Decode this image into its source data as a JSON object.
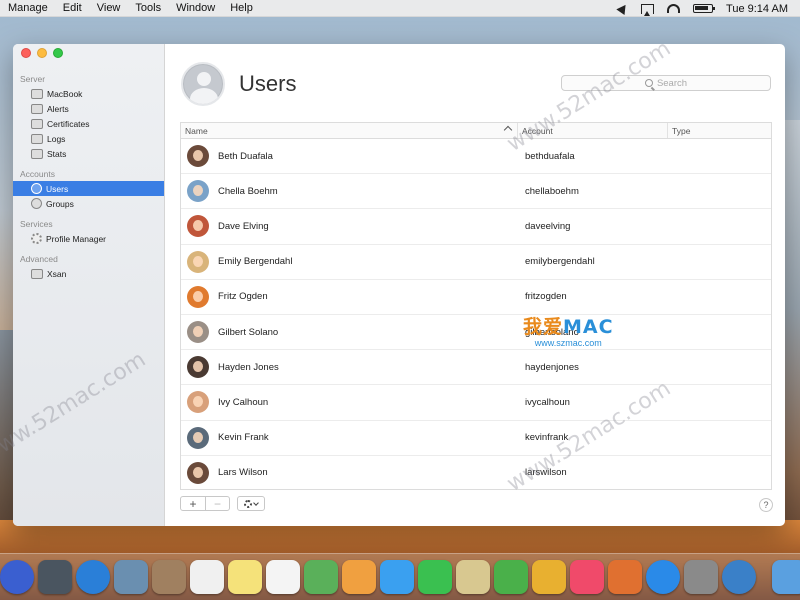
{
  "menubar": {
    "items": [
      "Manage",
      "Edit",
      "View",
      "Tools",
      "Window",
      "Help"
    ],
    "clock": "Tue 9:14 AM"
  },
  "sidebar": {
    "sections": [
      {
        "title": "Server",
        "items": [
          {
            "label": "MacBook",
            "icon": "laptop-icon"
          },
          {
            "label": "Alerts",
            "icon": "alert-icon"
          },
          {
            "label": "Certificates",
            "icon": "certificate-icon"
          },
          {
            "label": "Logs",
            "icon": "logs-icon"
          },
          {
            "label": "Stats",
            "icon": "stats-icon"
          }
        ]
      },
      {
        "title": "Accounts",
        "items": [
          {
            "label": "Users",
            "icon": "user-icon",
            "selected": true
          },
          {
            "label": "Groups",
            "icon": "groups-icon"
          }
        ]
      },
      {
        "title": "Services",
        "items": [
          {
            "label": "Profile Manager",
            "icon": "profile-manager-icon"
          }
        ]
      },
      {
        "title": "Advanced",
        "items": [
          {
            "label": "Xsan",
            "icon": "xsan-icon"
          }
        ]
      }
    ]
  },
  "main": {
    "title": "Users",
    "search_placeholder": "Search",
    "columns": {
      "name": "Name",
      "account": "Account",
      "type": "Type"
    },
    "users": [
      {
        "name": "Beth Duafala",
        "account": "bethduafala",
        "color": "#6b4a3a"
      },
      {
        "name": "Chella Boehm",
        "account": "chellaboehm",
        "color": "#7aa2c8"
      },
      {
        "name": "Dave Elving",
        "account": "daveelving",
        "color": "#c0563a"
      },
      {
        "name": "Emily Bergendahl",
        "account": "emilybergendahl",
        "color": "#d9b47a"
      },
      {
        "name": "Fritz Ogden",
        "account": "fritzogden",
        "color": "#e07a2e"
      },
      {
        "name": "Gilbert Solano",
        "account": "gilbertsolano",
        "color": "#9a8f86"
      },
      {
        "name": "Hayden Jones",
        "account": "haydenjones",
        "color": "#4a3a32"
      },
      {
        "name": "Ivy Calhoun",
        "account": "ivycalhoun",
        "color": "#d8a07a"
      },
      {
        "name": "Kevin Frank",
        "account": "kevinfrank",
        "color": "#5a6a7a"
      },
      {
        "name": "Lars Wilson",
        "account": "larswilson",
        "color": "#6a4a3a"
      }
    ],
    "add_label": "+",
    "remove_label": "−",
    "help_label": "?"
  },
  "watermarks": [
    "www.52mac.com",
    "www.52mac.com",
    "www.52mac.com"
  ],
  "logo": {
    "line1a": "我爱",
    "line1b": "MAC",
    "line2": "www.szmac.com"
  },
  "dock": {
    "colors": [
      "#3a5fd0",
      "#4a5560",
      "#2a7fd8",
      "#6a8fb0",
      "#a08060",
      "#f0f0f0",
      "#f5e27a",
      "#f4f4f4",
      "#5ab05a",
      "#f0a040",
      "#3aa0f0",
      "#3ac050",
      "#d8c890",
      "#4ab04a",
      "#e8b030",
      "#f04a6a",
      "#e07030",
      "#2a8ae8",
      "#8a8a8a",
      "#3a80c8",
      "#5aa0e0"
    ]
  }
}
